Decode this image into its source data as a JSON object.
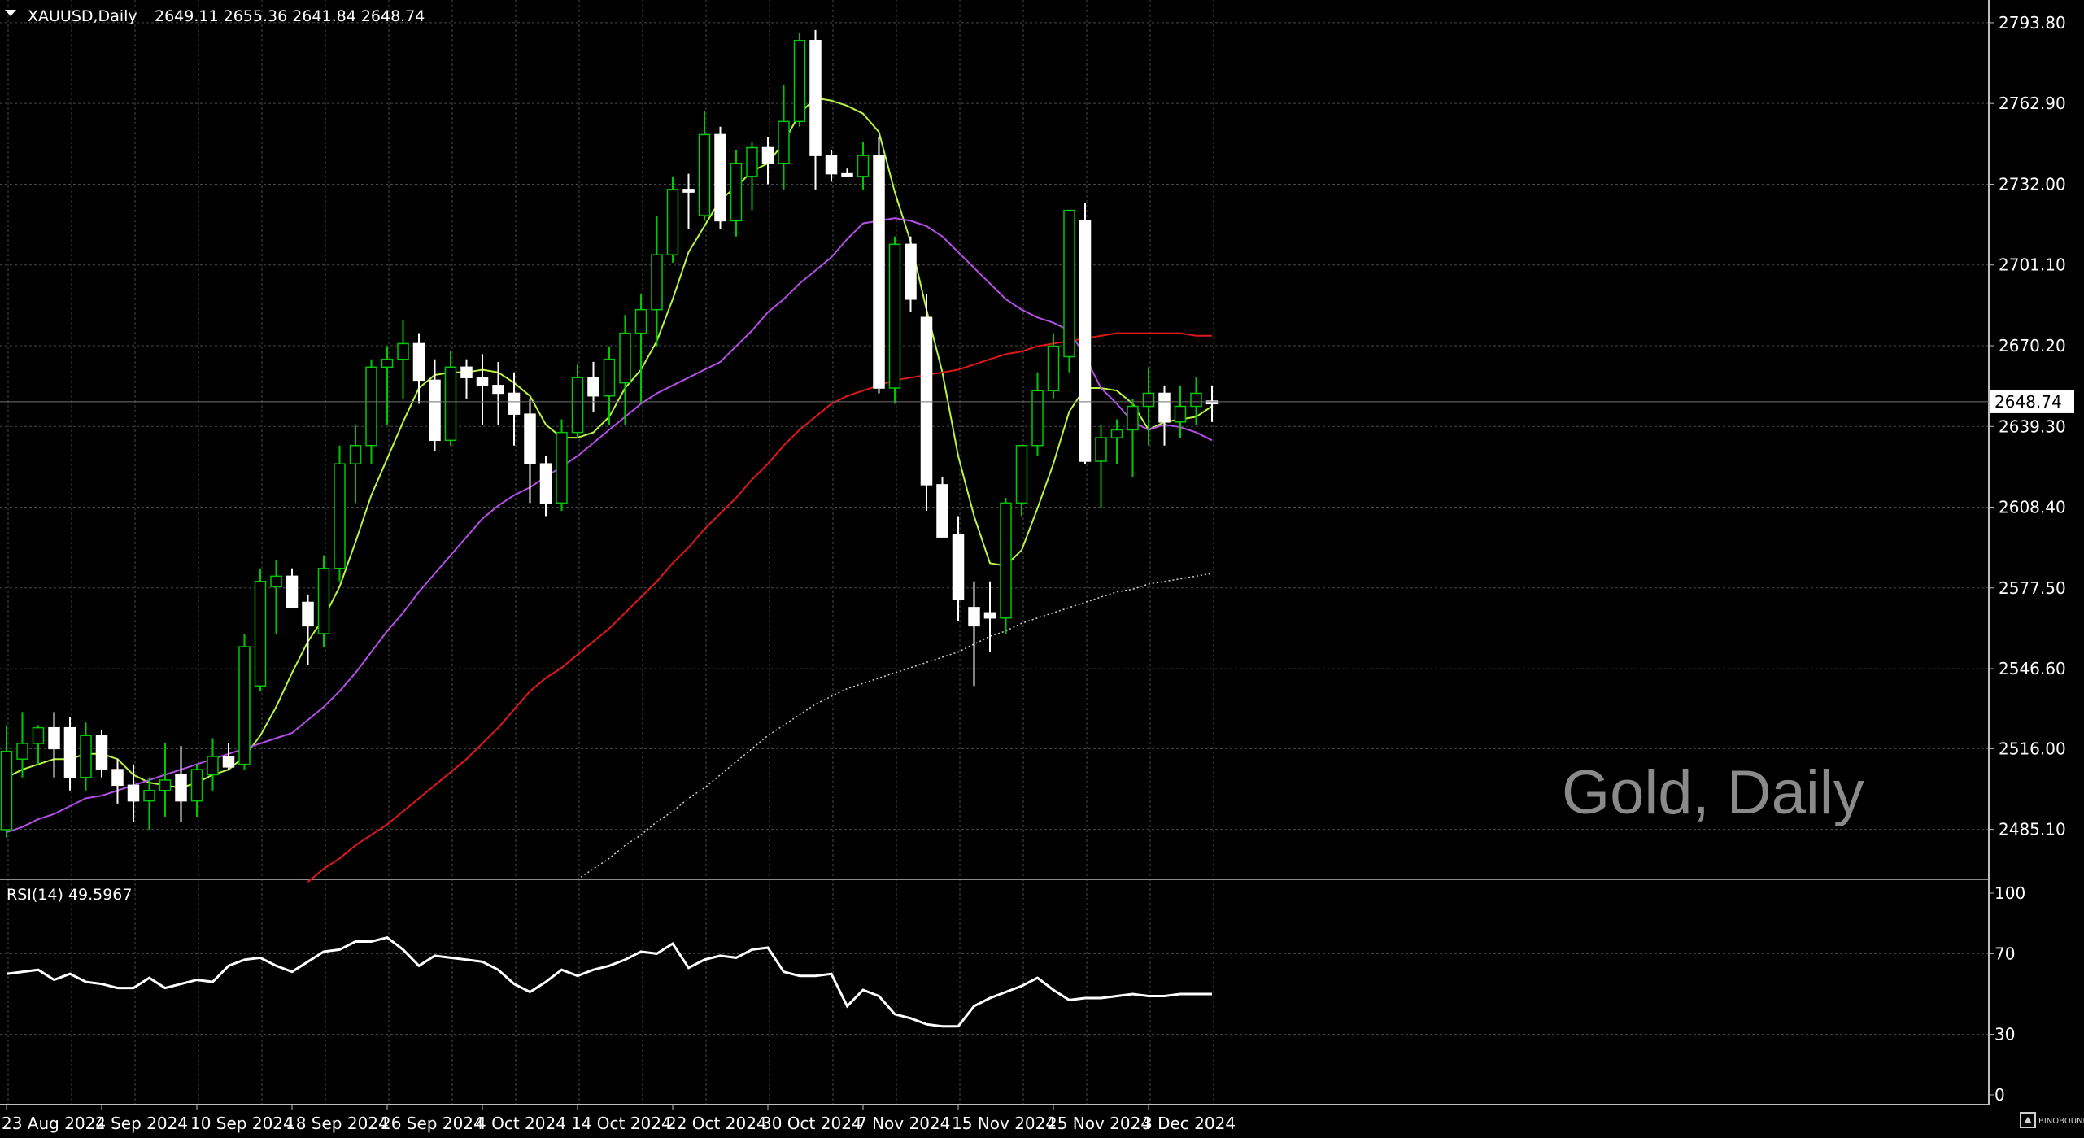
{
  "header": {
    "symbol": "XAUUSD,Daily",
    "ohlc": "2649.11 2655.36 2641.84 2648.74",
    "dropdown_icon": "triangle-down-icon"
  },
  "watermark": "Gold, Daily",
  "brand": "BINOBOUND",
  "colors": {
    "background": "#000000",
    "grid": "#4a4a4a",
    "candle_up_body": "#000000",
    "candle_up_border": "#00c800",
    "candle_down_body": "#ffffff",
    "candle_down_border": "#ffffff",
    "ma_fast": "#b7f542",
    "ma_mid": "#b44ee6",
    "ma_slow": "#e01818",
    "ma_long": "#cfcfcf",
    "rsi_line": "#ffffff",
    "price_line": "#707070"
  },
  "chart_data": {
    "type": "candlestick",
    "price_axis": {
      "ticks": [
        "2793.80",
        "2762.90",
        "2732.00",
        "2701.10",
        "2670.20",
        "2639.30",
        "2608.40",
        "2577.50",
        "2546.60",
        "2516.00",
        "2485.10"
      ],
      "ylim": [
        2466,
        2800
      ],
      "last_price": "2648.74"
    },
    "date_labels": [
      "23 Aug 2024",
      "2 Sep 2024",
      "10 Sep 2024",
      "18 Sep 2024",
      "26 Sep 2024",
      "4 Oct 2024",
      "14 Oct 2024",
      "22 Oct 2024",
      "30 Oct 2024",
      "7 Nov 2024",
      "15 Nov 2024",
      "25 Nov 2024",
      "3 Dec 2024"
    ],
    "date_label_index": [
      0,
      6,
      12,
      18,
      24,
      30,
      36,
      42,
      48,
      54,
      60,
      66,
      72
    ],
    "candles": [
      [
        2485,
        2525,
        2482,
        2515
      ],
      [
        2512,
        2530,
        2505,
        2518
      ],
      [
        2518,
        2525,
        2510,
        2524
      ],
      [
        2524,
        2530,
        2505,
        2516
      ],
      [
        2524,
        2528,
        2500,
        2505
      ],
      [
        2505,
        2526,
        2500,
        2521
      ],
      [
        2521,
        2523,
        2505,
        2508
      ],
      [
        2508,
        2512,
        2495,
        2502
      ],
      [
        2502,
        2510,
        2488,
        2496
      ],
      [
        2496,
        2505,
        2485,
        2500
      ],
      [
        2500,
        2518,
        2490,
        2504
      ],
      [
        2506,
        2517,
        2488,
        2496
      ],
      [
        2496,
        2510,
        2490,
        2508
      ],
      [
        2506,
        2520,
        2500,
        2513
      ],
      [
        2513,
        2518,
        2508,
        2509
      ],
      [
        2510,
        2560,
        2508,
        2555
      ],
      [
        2540,
        2585,
        2538,
        2580
      ],
      [
        2578,
        2588,
        2560,
        2582
      ],
      [
        2582,
        2585,
        2570,
        2570
      ],
      [
        2572,
        2575,
        2548,
        2563
      ],
      [
        2560,
        2590,
        2555,
        2585
      ],
      [
        2585,
        2632,
        2580,
        2625
      ],
      [
        2625,
        2640,
        2610,
        2632
      ],
      [
        2632,
        2665,
        2625,
        2662
      ],
      [
        2662,
        2670,
        2640,
        2665
      ],
      [
        2665,
        2680,
        2650,
        2671
      ],
      [
        2671,
        2675,
        2648,
        2657
      ],
      [
        2657,
        2665,
        2630,
        2634
      ],
      [
        2634,
        2668,
        2632,
        2662
      ],
      [
        2662,
        2665,
        2650,
        2658
      ],
      [
        2658,
        2667,
        2640,
        2655
      ],
      [
        2655,
        2664,
        2640,
        2652
      ],
      [
        2652,
        2660,
        2632,
        2644
      ],
      [
        2644,
        2650,
        2610,
        2625
      ],
      [
        2625,
        2628,
        2605,
        2610
      ],
      [
        2610,
        2642,
        2607,
        2637
      ],
      [
        2637,
        2663,
        2635,
        2658
      ],
      [
        2658,
        2664,
        2645,
        2651
      ],
      [
        2651,
        2670,
        2640,
        2665
      ],
      [
        2656,
        2682,
        2640,
        2675
      ],
      [
        2675,
        2690,
        2648,
        2684
      ],
      [
        2684,
        2720,
        2670,
        2705
      ],
      [
        2705,
        2735,
        2702,
        2730
      ],
      [
        2730,
        2736,
        2715,
        2729
      ],
      [
        2720,
        2760,
        2718,
        2751
      ],
      [
        2751,
        2754,
        2715,
        2718
      ],
      [
        2718,
        2745,
        2712,
        2740
      ],
      [
        2735,
        2748,
        2722,
        2746
      ],
      [
        2746,
        2750,
        2732,
        2740
      ],
      [
        2740,
        2770,
        2730,
        2756
      ],
      [
        2756,
        2790,
        2754,
        2787
      ],
      [
        2787,
        2791,
        2730,
        2743
      ],
      [
        2743,
        2745,
        2733,
        2736
      ],
      [
        2736,
        2738,
        2735,
        2735
      ],
      [
        2735,
        2748,
        2730,
        2743
      ],
      [
        2743,
        2750,
        2652,
        2654
      ],
      [
        2654,
        2712,
        2648,
        2709
      ],
      [
        2709,
        2712,
        2683,
        2688
      ],
      [
        2681,
        2690,
        2607,
        2617
      ],
      [
        2617,
        2620,
        2598,
        2597
      ],
      [
        2598,
        2605,
        2565,
        2573
      ],
      [
        2570,
        2580,
        2540,
        2563
      ],
      [
        2568,
        2580,
        2553,
        2566
      ],
      [
        2566,
        2612,
        2560,
        2610
      ],
      [
        2610,
        2632,
        2605,
        2632
      ],
      [
        2632,
        2660,
        2628,
        2653
      ],
      [
        2653,
        2675,
        2650,
        2670
      ],
      [
        2666,
        2722,
        2660,
        2722
      ],
      [
        2718,
        2725,
        2625,
        2626
      ],
      [
        2626,
        2640,
        2608,
        2635
      ],
      [
        2635,
        2642,
        2625,
        2638
      ],
      [
        2638,
        2650,
        2620,
        2647
      ],
      [
        2647,
        2662,
        2632,
        2652
      ],
      [
        2652,
        2655,
        2632,
        2641
      ],
      [
        2641,
        2655,
        2635,
        2647
      ],
      [
        2647,
        2658,
        2640,
        2652
      ],
      [
        2649,
        2655,
        2641,
        2648
      ]
    ],
    "moving_averages": [
      {
        "name": "ma_fast",
        "values": [
          2505,
          2508,
          2510,
          2512,
          2512,
          2514,
          2514,
          2512,
          2506,
          2503,
          2502,
          2501,
          2503,
          2506,
          2508,
          2513,
          2521,
          2532,
          2545,
          2557,
          2566,
          2578,
          2595,
          2613,
          2627,
          2641,
          2654,
          2659,
          2660,
          2660,
          2661,
          2660,
          2656,
          2651,
          2640,
          2635,
          2635,
          2637,
          2643,
          2654,
          2661,
          2672,
          2688,
          2706,
          2716,
          2726,
          2731,
          2737,
          2740,
          2748,
          2759,
          2765,
          2764,
          2762,
          2759,
          2752,
          2729,
          2710,
          2684,
          2660,
          2628,
          2605,
          2587,
          2586,
          2592,
          2608,
          2625,
          2645,
          2654,
          2654,
          2653,
          2648,
          2638,
          2641,
          2642,
          2643,
          2647
        ]
      },
      {
        "name": "ma_mid",
        "values": [
          2484,
          2486,
          2489,
          2491,
          2494,
          2497,
          2498,
          2500,
          2502,
          2504,
          2506,
          2508,
          2510,
          2512,
          2514,
          2516,
          2518,
          2520,
          2522,
          2527,
          2532,
          2538,
          2545,
          2553,
          2561,
          2568,
          2576,
          2583,
          2590,
          2597,
          2604,
          2609,
          2613,
          2616,
          2620,
          2624,
          2628,
          2633,
          2638,
          2643,
          2648,
          2652,
          2655,
          2658,
          2661,
          2664,
          2670,
          2676,
          2683,
          2688,
          2694,
          2699,
          2704,
          2711,
          2717,
          2718,
          2719,
          2718,
          2716,
          2712,
          2706,
          2700,
          2694,
          2688,
          2684,
          2681,
          2679,
          2676,
          2666,
          2654,
          2648,
          2641,
          2638,
          2640,
          2639,
          2637,
          2634
        ]
      },
      {
        "name": "ma_slow",
        "values": [
          null,
          null,
          null,
          null,
          null,
          null,
          null,
          null,
          null,
          null,
          null,
          null,
          null,
          null,
          null,
          null,
          null,
          null,
          null,
          2465,
          2470,
          2474,
          2479,
          2483,
          2487,
          2492,
          2497,
          2502,
          2507,
          2512,
          2518,
          2524,
          2531,
          2538,
          2543,
          2547,
          2552,
          2557,
          2562,
          2568,
          2574,
          2580,
          2587,
          2593,
          2600,
          2606,
          2612,
          2619,
          2625,
          2632,
          2638,
          2643,
          2648,
          2651,
          2653,
          2655,
          2657,
          2658,
          2659,
          2660,
          2661,
          2663,
          2665,
          2667,
          2668,
          2670,
          2671,
          2672,
          2673,
          2674,
          2675,
          2675,
          2675,
          2675,
          2675,
          2674,
          2674
        ]
      },
      {
        "name": "ma_long",
        "values": [
          null,
          null,
          null,
          null,
          null,
          null,
          null,
          null,
          null,
          null,
          null,
          null,
          null,
          null,
          null,
          null,
          null,
          null,
          null,
          null,
          null,
          null,
          null,
          null,
          null,
          null,
          null,
          null,
          null,
          null,
          null,
          null,
          null,
          null,
          null,
          null,
          2466,
          2470,
          2474,
          2479,
          2483,
          2488,
          2492,
          2497,
          2501,
          2506,
          2511,
          2516,
          2521,
          2525,
          2529,
          2533,
          2536,
          2539,
          2541,
          2543,
          2545,
          2547,
          2549,
          2551,
          2553,
          2556,
          2559,
          2561,
          2564,
          2566,
          2568,
          2570,
          2572,
          2574,
          2576,
          2577,
          2579,
          2580,
          2581,
          2582,
          2583
        ]
      }
    ],
    "rsi": {
      "label": "RSI(14) 49.5967",
      "levels": [
        "100",
        "70",
        "30",
        "0"
      ],
      "ylim": [
        0,
        100
      ],
      "values": [
        60,
        61,
        62,
        57,
        60,
        56,
        55,
        53,
        53,
        58,
        53,
        55,
        57,
        56,
        64,
        67,
        68,
        64,
        61,
        66,
        71,
        72,
        76,
        76,
        78,
        72,
        64,
        69,
        68,
        67,
        66,
        62,
        55,
        51,
        56,
        62,
        59,
        62,
        64,
        67,
        71,
        70,
        75,
        63,
        67,
        69,
        68,
        72,
        73,
        61,
        59,
        59,
        60,
        44,
        52,
        49,
        40,
        38,
        35,
        34,
        34,
        44,
        48,
        51,
        54,
        58,
        52,
        47,
        48,
        48,
        49,
        50,
        49,
        49,
        50,
        50,
        50
      ]
    }
  }
}
